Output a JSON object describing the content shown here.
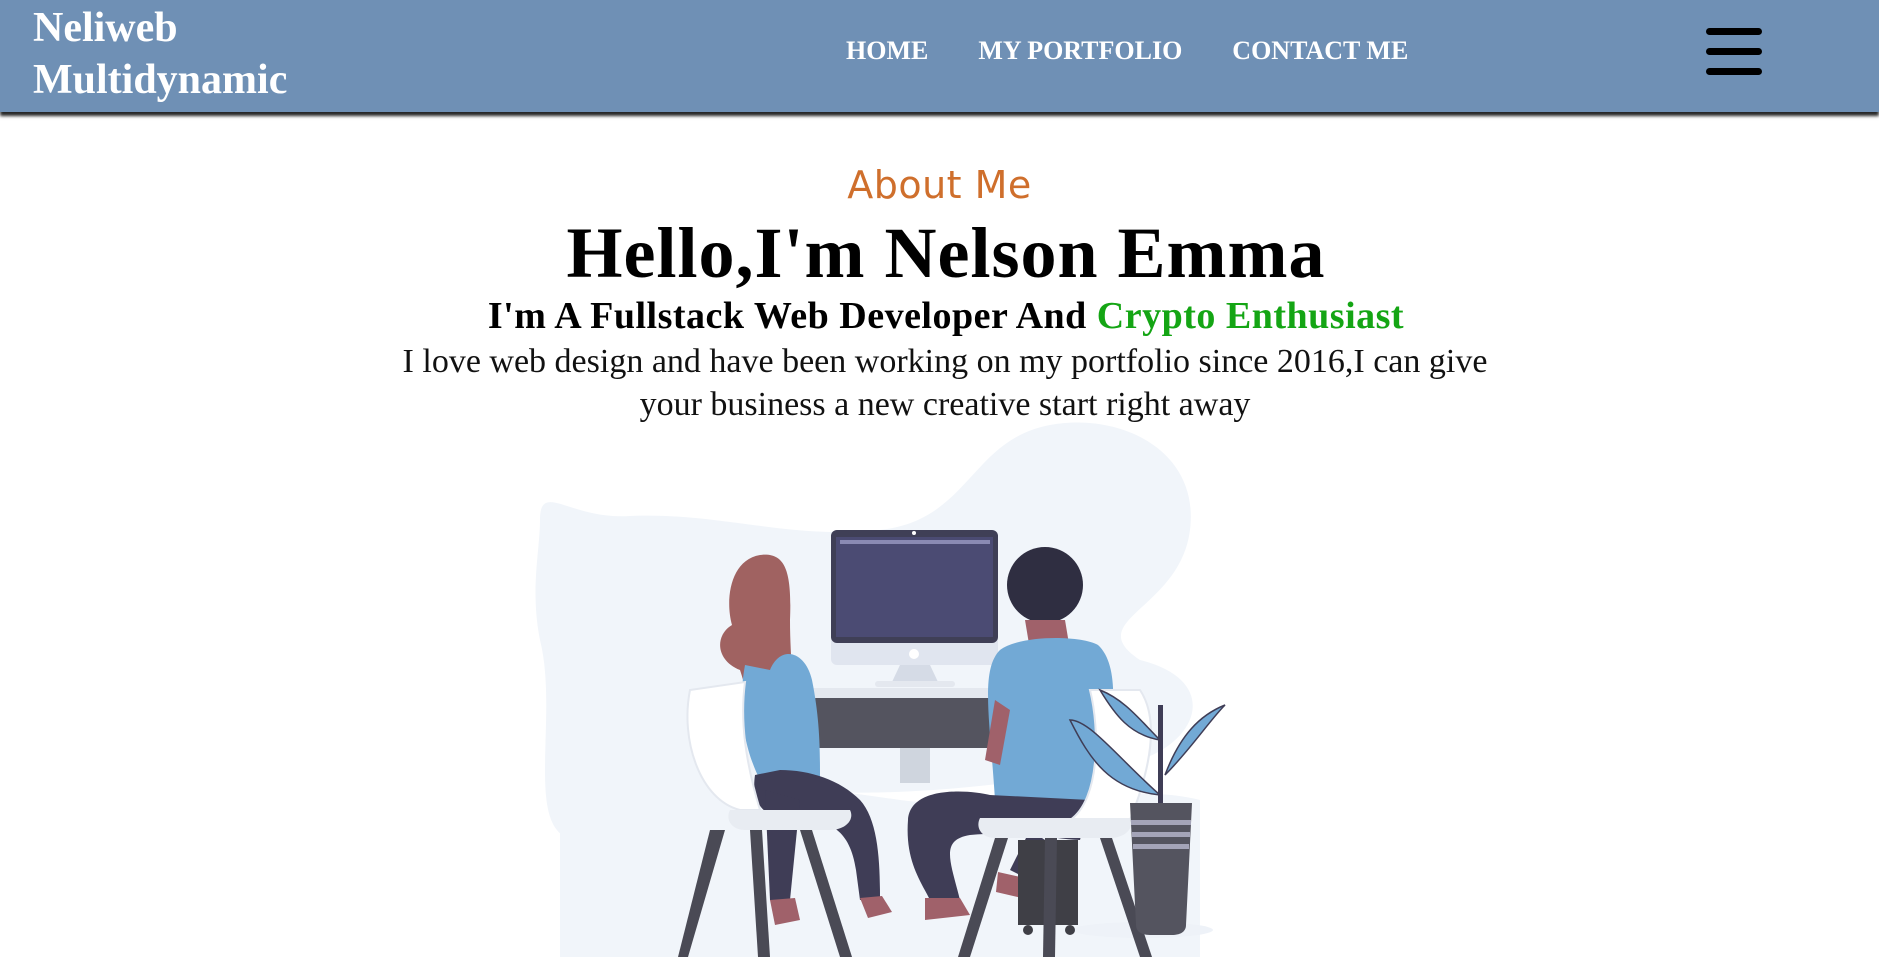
{
  "brand": {
    "line1": "Neliweb",
    "line2": "Multidynamic"
  },
  "nav": {
    "items": [
      {
        "label": "HOME"
      },
      {
        "label": "MY PORTFOLIO"
      },
      {
        "label": "CONTACT ME"
      }
    ]
  },
  "menu_icon": "hamburger-menu-icon",
  "about": {
    "label": "About Me",
    "title": "Hello,I'm Nelson Emma",
    "subtitle_plain": "I'm A Fullstack Web Developer And ",
    "subtitle_accent": "Crypto Enthusiast",
    "description": "I love web design and have been working on my portfolio since 2016,I can give your business a new creative start right away"
  },
  "colors": {
    "navbar": "#6f90b5",
    "about_label": "#cf6f2c",
    "accent_green": "#14a514",
    "blob": "#f1f5fa",
    "shirt_blue": "#72a9d5",
    "monitor_screen": "#4b4b73",
    "dark": "#4a4a55"
  }
}
